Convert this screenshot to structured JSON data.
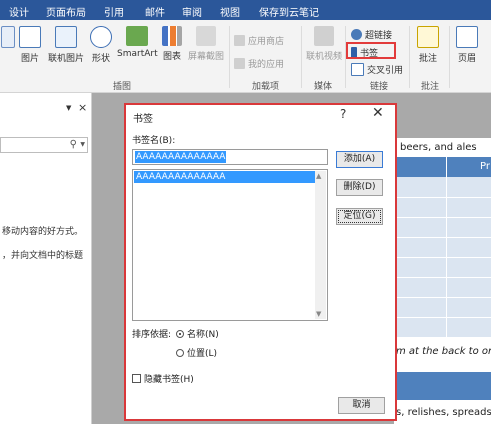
{
  "ribbon_tabs": [
    "设计",
    "页面布局",
    "引用",
    "邮件",
    "审阅",
    "视图",
    "保存到云笔记"
  ],
  "ribbon": {
    "buttons": {
      "picture": "图片",
      "online_picture": "联机图片",
      "shapes": "形状",
      "smartart": "SmartArt",
      "chart": "图表",
      "screenshot": "屏幕截图",
      "app_store": "应用商店",
      "my_apps": "我的应用",
      "online_video": "联机视频",
      "hyperlink": "超链接",
      "bookmark": "书签",
      "cross_reference": "交叉引用",
      "comment": "批注",
      "header": "页眉"
    },
    "groups": {
      "illustrations": "插图",
      "addins": "加载项",
      "media": "媒体",
      "links": "链接",
      "comments": "批注"
    }
  },
  "nav_pane": {
    "close": "×",
    "text_line1": "移动内容的好方式。",
    "text_line2": "，并向文档中的标题"
  },
  "document": {
    "line1": "beers, and ales",
    "table_header_fragment": "Pr",
    "line_middle": "m at the back to or",
    "line_bottom": "s, relishes, spreads,"
  },
  "dialog": {
    "title": "书签",
    "help": "?",
    "close": "✕",
    "name_label": "书签名(B):",
    "name_value": "AAAAAAAAAAAAAA",
    "list_items": [
      "AAAAAAAAAAAAAA"
    ],
    "buttons": {
      "add": "添加(A)",
      "delete": "删除(D)",
      "goto": "定位(G)",
      "cancel": "取消"
    },
    "sort_label": "排序依据:",
    "sort_options": [
      {
        "label": "名称(N)",
        "selected": true
      },
      {
        "label": "位置(L)",
        "selected": false
      }
    ],
    "hidden_bookmarks": {
      "label": "隐藏书签(H)",
      "checked": false
    }
  }
}
